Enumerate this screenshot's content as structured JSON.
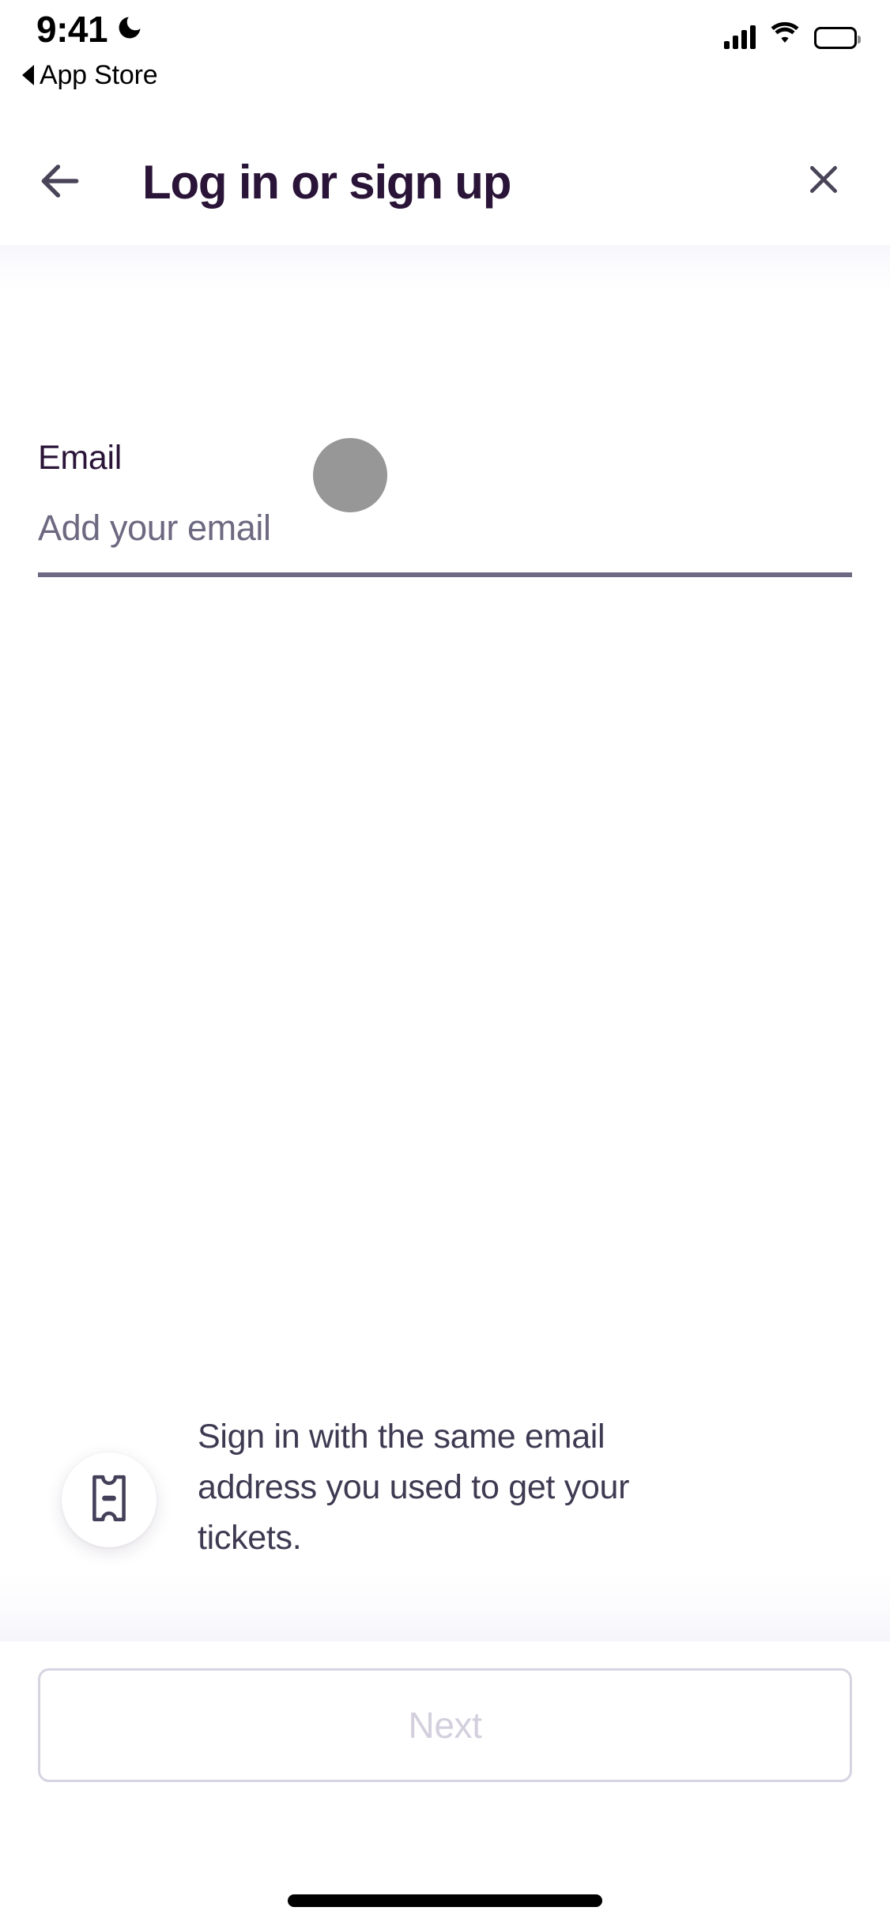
{
  "status_bar": {
    "time": "9:41",
    "dnd_icon": "crescent-moon-icon",
    "back_app_label": "App Store",
    "back_triangle_icon": "triangle-left-icon",
    "cellular_icon": "cellular-signal-icon",
    "cellular_bars": 4,
    "wifi_icon": "wifi-icon",
    "battery_icon": "battery-full-icon"
  },
  "nav_bar": {
    "back_icon": "arrow-left-icon",
    "title": "Log in or sign up",
    "close_icon": "close-x-icon"
  },
  "form": {
    "email_field": {
      "label": "Email",
      "placeholder": "Add your email",
      "value": "",
      "spinner_icon": "loading-circle-icon"
    }
  },
  "hint": {
    "icon": "ticket-icon",
    "text": "Sign in with the same email address you used to get your tickets."
  },
  "bottom_bar": {
    "next_label": "Next",
    "next_disabled": true
  },
  "home_indicator": "home-indicator-bar",
  "colors": {
    "title_purple": "#2A1438",
    "icon_gray": "#4A4458",
    "placeholder_gray": "#6E6880",
    "underline": "#6E6880",
    "spinner_gray": "#979797",
    "hint_text": "#3F3A52",
    "button_border_disabled": "#D7D3E1",
    "button_text_disabled": "#D3CFDD",
    "background": "#FFFFFF"
  }
}
